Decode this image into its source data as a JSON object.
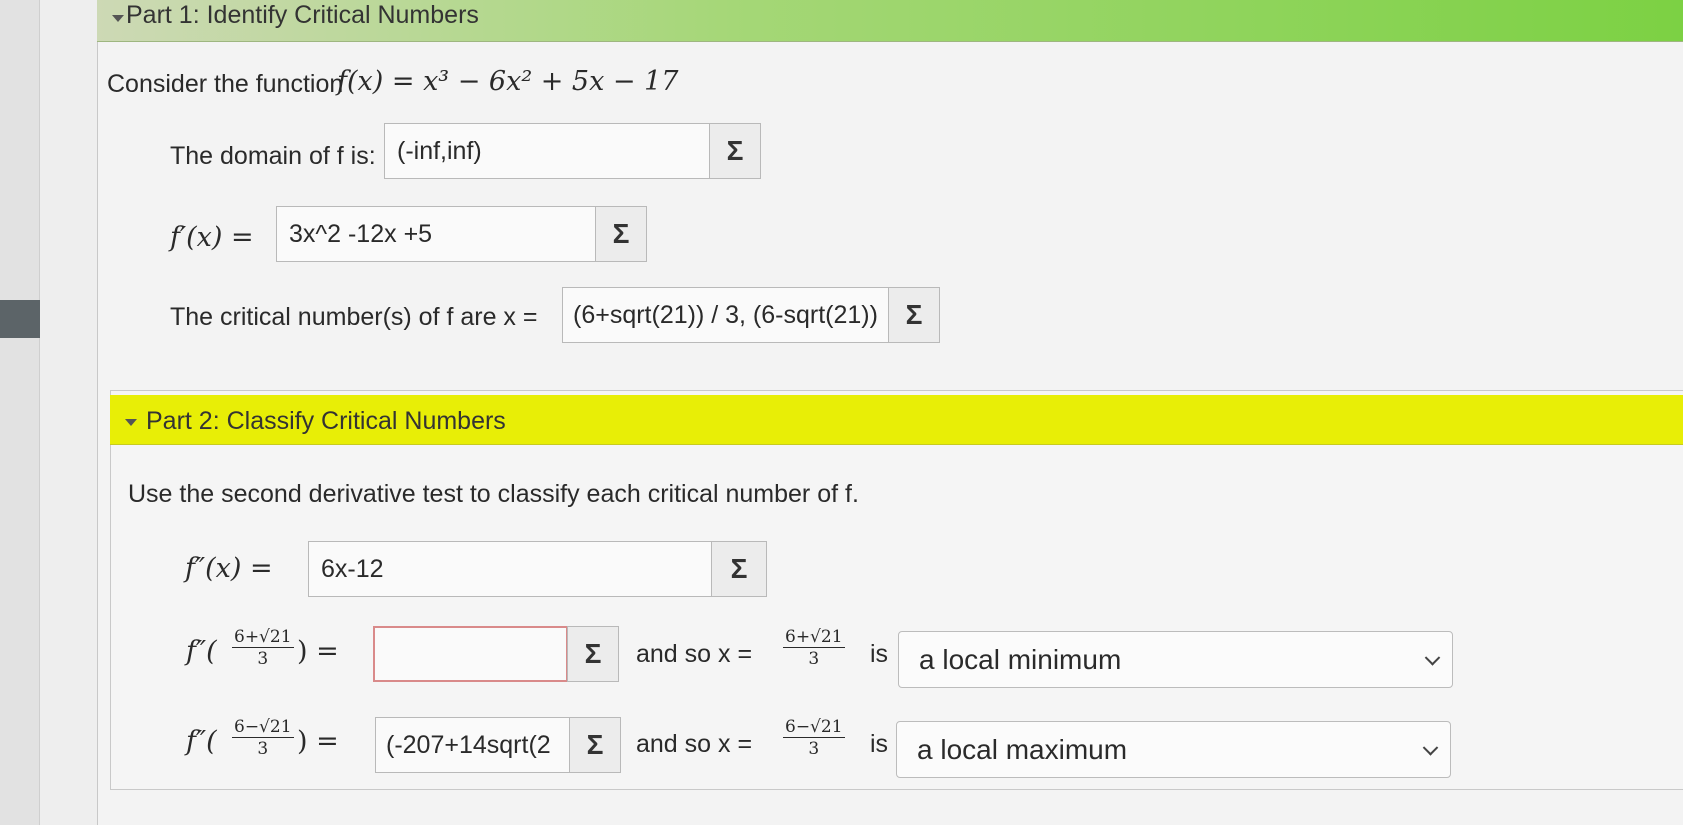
{
  "part1": {
    "header": "Part 1: Identify Critical Numbers",
    "intro_prefix": "Consider the function",
    "function_expr": "f(x) = x³ − 6x² + 5x − 17",
    "domain_label": "The domain of f is:",
    "domain_value": "(-inf,inf)",
    "derivative_label": "f′(x) =",
    "derivative_value": "3x^2 -12x +5",
    "critical_label": "The critical number(s) of f are x =",
    "critical_value": "(6+sqrt(21)) / 3, (6-sqrt(21))"
  },
  "part2": {
    "header": "Part 2: Classify Critical Numbers",
    "instruction": "Use the second derivative test to classify each critical number of f.",
    "second_derivative_label": "f″(x) =",
    "second_derivative_value": "6x-12",
    "rows": [
      {
        "func_prefix": "f″(",
        "num": "6+√21",
        "den": "3",
        "func_suffix": ") =",
        "value": "",
        "and_so": "and so x =",
        "x_num": "6+√21",
        "x_den": "3",
        "is": "is",
        "classification": "a local minimum"
      },
      {
        "func_prefix": "f″(",
        "num": "6−√21",
        "den": "3",
        "func_suffix": ") =",
        "value": "(-207+14sqrt(2",
        "and_so": "and so x =",
        "x_num": "6−√21",
        "x_den": "3",
        "is": "is",
        "classification": "a local maximum"
      }
    ]
  },
  "icons": {
    "sigma": "Σ",
    "collapse": "triangle-down-icon",
    "dropdown": "chevron-down-icon"
  },
  "colors": {
    "part1_header": "#7cd143",
    "part2_header": "#e8ee06"
  }
}
